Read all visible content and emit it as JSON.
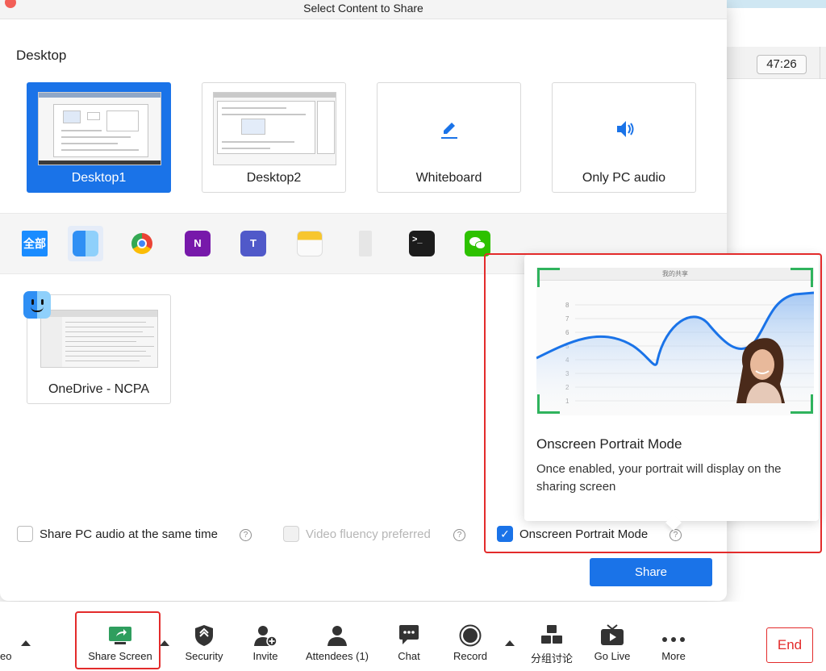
{
  "dialog": {
    "title": "Select Content to Share",
    "section_label": "Desktop",
    "tiles": [
      {
        "label": "Desktop1",
        "selected": true
      },
      {
        "label": "Desktop2",
        "selected": false
      },
      {
        "label": "Whiteboard",
        "icon": "pen-icon"
      },
      {
        "label": "Only PC audio",
        "icon": "speaker-icon"
      }
    ],
    "app_filters": [
      {
        "name": "all",
        "label": "全部",
        "color": "#1a8cff"
      },
      {
        "name": "finder",
        "icon": "finder-icon",
        "selected": true
      },
      {
        "name": "chrome",
        "icon": "chrome-icon"
      },
      {
        "name": "onenote",
        "icon": "onenote-icon",
        "color": "#7719aa"
      },
      {
        "name": "teams",
        "icon": "teams-icon",
        "color": "#5059c9"
      },
      {
        "name": "notes",
        "icon": "notes-icon",
        "color": "#f7c62f"
      },
      {
        "name": "printer",
        "icon": "printer-icon"
      },
      {
        "name": "terminal",
        "icon": "terminal-icon",
        "color": "#1c1c1c"
      },
      {
        "name": "wechat",
        "icon": "wechat-icon",
        "color": "#2dc100"
      }
    ],
    "window_tile": {
      "label": "OneDrive - NCPA"
    },
    "options": {
      "share_audio": {
        "label": "Share PC audio at the same time",
        "checked": false
      },
      "video_fluency": {
        "label": "Video fluency preferred",
        "checked": false,
        "disabled": true
      },
      "portrait_mode": {
        "label": "Onscreen Portrait Mode",
        "checked": true
      }
    },
    "share_label": "Share"
  },
  "popover": {
    "preview_header": "我的共享",
    "title": "Onscreen Portrait Mode",
    "description": "Once enabled, your portrait will display on the sharing screen"
  },
  "meeting": {
    "timer": "47:26"
  },
  "toolbar": {
    "video_label_partial": "eo",
    "items": [
      {
        "label": "Share Screen",
        "icon": "share-screen-icon"
      },
      {
        "label": "Security",
        "icon": "shield-icon"
      },
      {
        "label": "Invite",
        "icon": "add-user-icon"
      },
      {
        "label": "Attendees (1)",
        "icon": "attendees-icon"
      },
      {
        "label": "Chat",
        "icon": "chat-icon"
      },
      {
        "label": "Record",
        "icon": "record-icon"
      },
      {
        "label": "分组讨论",
        "icon": "breakout-icon"
      },
      {
        "label": "Go Live",
        "icon": "live-icon"
      },
      {
        "label": "More",
        "icon": "more-icon"
      }
    ],
    "end_label": "End"
  },
  "colors": {
    "accent": "#1a73e8",
    "highlight": "#e32b2b",
    "frame_green": "#2fb35d"
  }
}
